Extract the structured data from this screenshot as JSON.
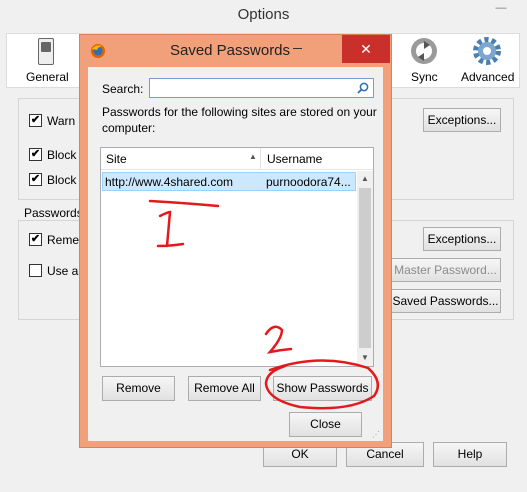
{
  "window": {
    "title": "Options",
    "minimize_glyph": "—"
  },
  "toolbar": [
    {
      "label": "General",
      "icon": "switch-icon"
    },
    {
      "label": "Sync",
      "icon": "sync-icon"
    },
    {
      "label": "Advanced",
      "icon": "gear-icon"
    }
  ],
  "options": {
    "check_warn": "Warn",
    "check_block1": "Block",
    "check_block2": "Block",
    "passwords_group": "Passwords",
    "check_remember": "Remem",
    "check_use": "Use a",
    "exceptions1": "Exceptions...",
    "exceptions2": "Exceptions...",
    "master_password": "Master Password...",
    "saved_passwords": "Saved Passwords...",
    "ok": "OK",
    "cancel": "Cancel",
    "help": "Help"
  },
  "dialog": {
    "title": "Saved Passwords",
    "close_glyph": "✕",
    "search_label": "Search:",
    "search_value": "",
    "description": "Passwords for the following sites are stored on your computer:",
    "columns": {
      "site": "Site",
      "username": "Username"
    },
    "rows": [
      {
        "site": "http://www.4shared.com",
        "username": "purnoodora74..."
      }
    ],
    "remove": "Remove",
    "remove_all": "Remove All",
    "show_passwords": "Show Passwords",
    "close": "Close"
  },
  "annotations": {
    "one": "1",
    "two": "2"
  },
  "colors": {
    "dialog_frame": "#f2a07a",
    "close_button": "#c9302c",
    "selection": "#cce8ff",
    "annotation": "#e3191c"
  }
}
